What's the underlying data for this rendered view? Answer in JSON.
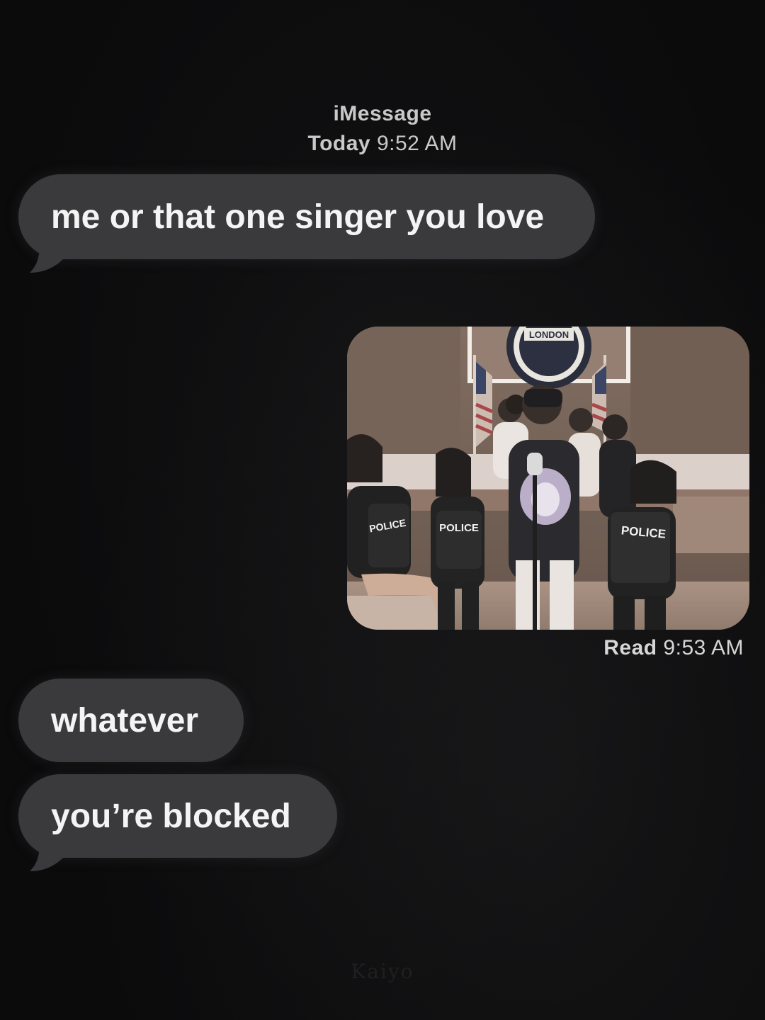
{
  "header": {
    "service": "iMessage",
    "day": "Today",
    "time": "9:52 AM"
  },
  "messages": [
    {
      "text": "me or that one singer you love",
      "direction": "incoming"
    },
    {
      "text": "whatever",
      "direction": "incoming"
    },
    {
      "text": "you’re blocked",
      "direction": "incoming"
    }
  ],
  "photo": {
    "seal_text": "LONDON",
    "vest_labels": [
      "POLICE",
      "POLICE",
      "POLICE"
    ]
  },
  "receipt": {
    "label": "Read",
    "time": "9:53 AM"
  },
  "watermark": "Kaiyo",
  "colors": {
    "background": "#0b0b0c",
    "bubble_incoming": "#3a3a3c",
    "text": "#f4f4f4",
    "meta_text": "#c9c9c9"
  }
}
